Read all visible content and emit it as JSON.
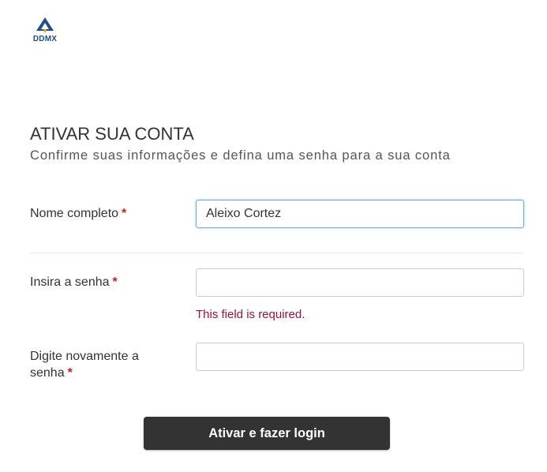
{
  "brand": {
    "logo_text": "DDMX",
    "logo_icon": "ddmx-triangle-logo",
    "color": "#1f4e8a"
  },
  "header": {
    "title": "ATIVAR SUA CONTA",
    "subtitle": "Confirme suas informações e defina uma senha para a sua conta"
  },
  "form": {
    "full_name": {
      "label": "Nome completo",
      "required_mark": "*",
      "value": "Aleixo Cortez"
    },
    "password": {
      "label": "Insira a senha",
      "required_mark": "*",
      "value": "",
      "error": "This field is required."
    },
    "confirm_password": {
      "label_line1": "Digite novamente a",
      "label_line2": "senha",
      "required_mark": "*",
      "value": ""
    },
    "submit_label": "Ativar e fazer login"
  },
  "colors": {
    "required": "#cc1f1f",
    "error": "#a30f3a",
    "button_bg": "#333333",
    "focus_border": "#74a9d8"
  }
}
